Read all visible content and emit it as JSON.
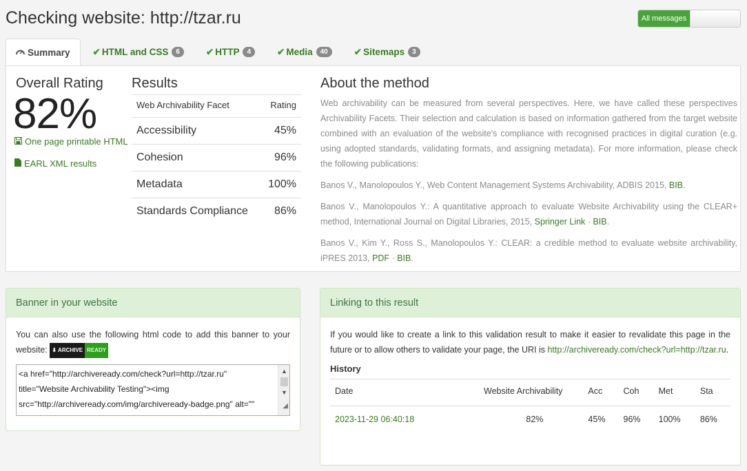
{
  "page_title": "Checking website: http://tzar.ru",
  "toggle": {
    "on_label": "All messages"
  },
  "tabs": [
    {
      "label": "Summary",
      "icon": "dashboard-icon",
      "badge": null
    },
    {
      "label": "HTML and CSS",
      "icon": "check-icon",
      "badge": "6"
    },
    {
      "label": "HTTP",
      "icon": "check-icon",
      "badge": "4"
    },
    {
      "label": "Media",
      "icon": "check-icon",
      "badge": "40"
    },
    {
      "label": "Sitemaps",
      "icon": "check-icon",
      "badge": "3"
    }
  ],
  "overall": {
    "label": "Overall Rating",
    "value": "82%",
    "links": [
      {
        "label": "One page printable HTML",
        "icon": "save-icon"
      },
      {
        "label": "EARL XML results",
        "icon": "file-icon"
      }
    ]
  },
  "results": {
    "title": "Results",
    "header": [
      "Web Archivability Facet",
      "Rating"
    ],
    "rows": [
      [
        "Accessibility",
        "45%"
      ],
      [
        "Cohesion",
        "96%"
      ],
      [
        "Metadata",
        "100%"
      ],
      [
        "Standards Compliance",
        "86%"
      ]
    ]
  },
  "about": {
    "title": "About the method",
    "intro": "Web archivability can be measured from several perspectives. Here, we have called these perspectives Archivability Facets. Their selection and calculation is based on information gathered from the target website combined with an evaluation of the website's compliance with recognised practices in digital curation (e.g. using adopted standards, validating formats, and assigning metadata). For more information, please check the following publications:",
    "pub1_text": "Banos V., Manolopoulos Y., Web Content Management Systems Archivability, ADBIS 2015,",
    "pub1_link": "BIB",
    "pub2_text": "Banos V., Manolopoulos Y.: A quantitative approach to evaluate Website Archivability using the CLEAR+ method, International Journal on Digital Libraries, 2015,",
    "pub2_link1": "Springer Link",
    "pub2_link2": "BIB",
    "pub3_text": "Banos V., Kim Y., Ross S., Manolopoulos Y.: CLEAR: a credible method to evaluate website archivability, iPRES 2013,",
    "pub3_link1": "PDF",
    "pub3_link2": "BIB",
    "sep": "·"
  },
  "banner": {
    "title": "Banner in your website",
    "text": "You can also use the following html code to add this banner to your website:",
    "badge_left": "ARCHIVE",
    "badge_right": "READY",
    "code_line1": "<a href=\"http://archiveready.com/check?url=http://tzar.ru\"",
    "code_line2": "title=\"Website Archivability Testing\"><img",
    "code_line3": "src=\"http://archiveready.com/img/archiveready-badge.png\" alt=\"\""
  },
  "linking": {
    "title": "Linking to this result",
    "text": "If you would like to create a link to this validation result to make it easier to revalidate this page in the future or to allow others to validate your page, the URI is",
    "uri": "http://archiveready.com/check?url=http://tzar.ru",
    "history_title": "History",
    "history_header": [
      "Date",
      "Website Archivability",
      "Acc",
      "Coh",
      "Met",
      "Sta"
    ],
    "history_rows": [
      [
        "2023-11-29 06:40:18",
        "82%",
        "45%",
        "96%",
        "100%",
        "86%"
      ]
    ]
  },
  "colors": {
    "accent_green": "#3a7a25",
    "panel_header_bg": "#dff0d8",
    "toggle_on": "#4aa33a"
  }
}
